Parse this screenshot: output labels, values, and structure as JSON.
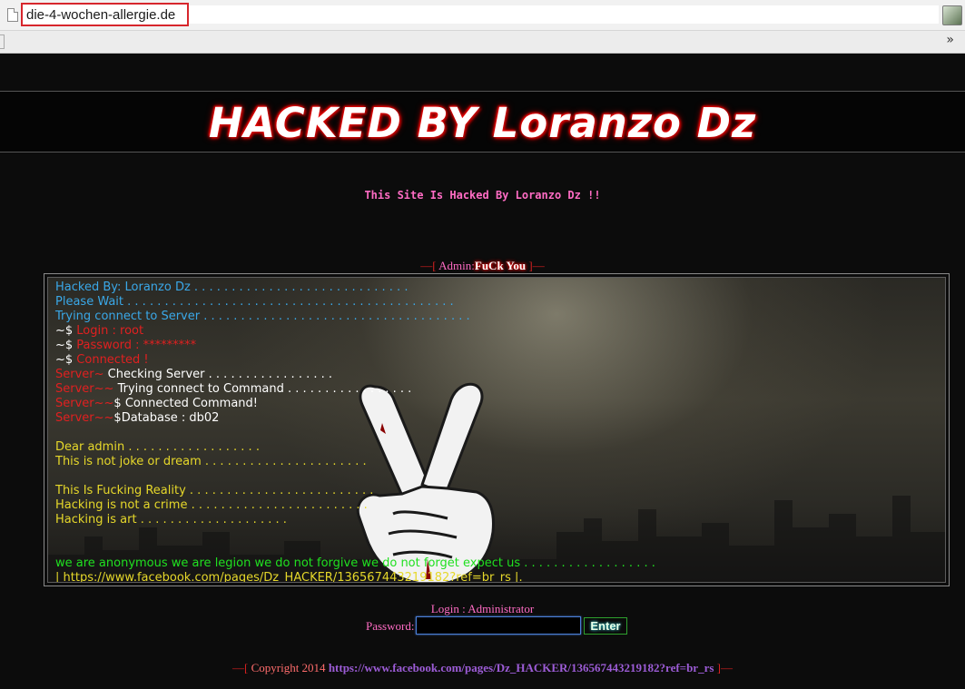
{
  "browser": {
    "url": "die-4-wochen-allergie.de",
    "bookmarks_chevron": "»"
  },
  "banner": {
    "title": "HACKED BY Loranzo Dz"
  },
  "subtitle": "This Site Is Hacked By Loranzo Dz !!",
  "admin_line": {
    "left_dash": "—[ ",
    "label": "Admin:",
    "value": "FuCk You",
    "right_dash": " ]—"
  },
  "terminal": {
    "lines": [
      [
        {
          "text": "Hacked By: Loranzo Dz . . . . . . . . . . . . . . . . . . . . . . . . . . . . .",
          "color": "blue"
        }
      ],
      [
        {
          "text": "Please Wait . . . . . . . . . . . . . . . . . . . . . . . . . . . . . . . . . . . . . . . . . . . .",
          "color": "blue"
        }
      ],
      [
        {
          "text": "Trying connect to Server . . . . . . . . . . . . . . . . . . . . . . . . . . . . . . . . . . . .",
          "color": "blue"
        }
      ],
      [
        {
          "text": "~$ ",
          "color": "white"
        },
        {
          "text": "Login : root",
          "color": "red"
        }
      ],
      [
        {
          "text": "~$ ",
          "color": "white"
        },
        {
          "text": "Password : *********",
          "color": "red"
        }
      ],
      [
        {
          "text": "~$ ",
          "color": "white"
        },
        {
          "text": "Connected !",
          "color": "red"
        }
      ],
      [
        {
          "text": "Server~ ",
          "color": "red"
        },
        {
          "text": "Checking Server . . . . . . . . . . . . . . . . .",
          "color": "white"
        }
      ],
      [
        {
          "text": "Server~~ ",
          "color": "red"
        },
        {
          "text": "Trying connect to Command . . . . . . . . . . . . . . . . .",
          "color": "white"
        }
      ],
      [
        {
          "text": "Server~~",
          "color": "red"
        },
        {
          "text": "$ Connected Command!",
          "color": "white"
        }
      ],
      [
        {
          "text": "Server~~",
          "color": "red"
        },
        {
          "text": "$Database : db02",
          "color": "white"
        }
      ],
      [
        {
          "text": "",
          "color": "white"
        }
      ],
      [
        {
          "text": "Dear admin . . . . . . . . . . . . . . . . . .",
          "color": "yellow"
        }
      ],
      [
        {
          "text": "This is not joke or dream . . . . . . . . . . . . . . . . . . . . . .",
          "color": "yellow"
        }
      ],
      [
        {
          "text": "",
          "color": "white"
        }
      ],
      [
        {
          "text": "This Is Fucking Reality . . . . . . . . . . . . . . . . . . . . . . . . .",
          "color": "yellow"
        }
      ],
      [
        {
          "text": "Hacking is not a crime . . . . . . . . . . . . . . . . . . . . . . . .",
          "color": "yellow"
        }
      ],
      [
        {
          "text": "Hacking is art . . . . . . . . . . . . . . . . . . . .",
          "color": "yellow"
        }
      ],
      [
        {
          "text": "",
          "color": "white"
        }
      ],
      [
        {
          "text": "",
          "color": "white"
        }
      ],
      [
        {
          "text": "we are anonymous we are legion we do not forgive we do not forget expect us . . . . . . . . . . . . . . . . . .",
          "color": "green"
        }
      ],
      [
        {
          "text": "| https://www.facebook.com/pages/Dz_HACKER/136567443219182?ref=br_rs |.",
          "color": "yellow"
        }
      ]
    ]
  },
  "login": {
    "label": "Login : Administrator",
    "password_label": "Password:",
    "password_value": "",
    "enter_label": "Enter"
  },
  "copyright": {
    "left_dash": "—[ ",
    "text": "Copyright 2014 ",
    "link": "https://www.facebook.com/pages/Dz_HACKER/136567443219182?ref=br_rs",
    "right_dash": " ]—"
  },
  "colors": {
    "blue": "#3aa8e8",
    "red": "#e02020",
    "white": "#ffffff",
    "yellow": "#e6d82a",
    "green": "#20e020",
    "pink": "#ff6cc4"
  }
}
